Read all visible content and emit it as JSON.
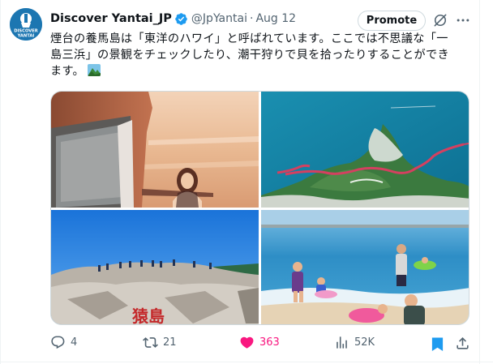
{
  "tweet": {
    "author": {
      "display_name": "Discover Yantai_JP",
      "handle": "@JpYantai",
      "verified": true,
      "avatar_text_line1": "DISCOVER",
      "avatar_text_line2": "YANTAI"
    },
    "separator": "·",
    "date": "Aug 12",
    "promote_label": "Promote",
    "text_lines": [
      "煙台の養馬島は「東洋のハワイ」と呼ばれています。ここでは不思議な「一",
      "島三浜」の景観をチェックしたり、潮干狩りで貝を拾ったりすることができ",
      "ます。"
    ],
    "inline_emoji": "mountain-landscape-emoji",
    "photos": [
      "woman-at-seaside-sunset-photo",
      "aerial-coastline-boardwalk-photo",
      "rocky-coast-sign-photo",
      "family-at-beach-photo"
    ],
    "rock_inscription": "猿島",
    "stats": {
      "replies": "4",
      "reposts": "21",
      "likes": "363",
      "views": "52K"
    },
    "icons": {
      "verified": "verified-badge-icon",
      "grok": "grok-icon",
      "more": "more-icon",
      "reply": "reply-icon",
      "repost": "repost-icon",
      "like": "heart-icon",
      "views": "views-chart-icon",
      "bookmark": "bookmark-icon",
      "share": "share-icon"
    },
    "colors": {
      "text": "#0f1419",
      "secondary": "#536471",
      "like": "#f91880",
      "bookmark": "#1d9bf0",
      "verified": "#1d9bf0"
    }
  }
}
